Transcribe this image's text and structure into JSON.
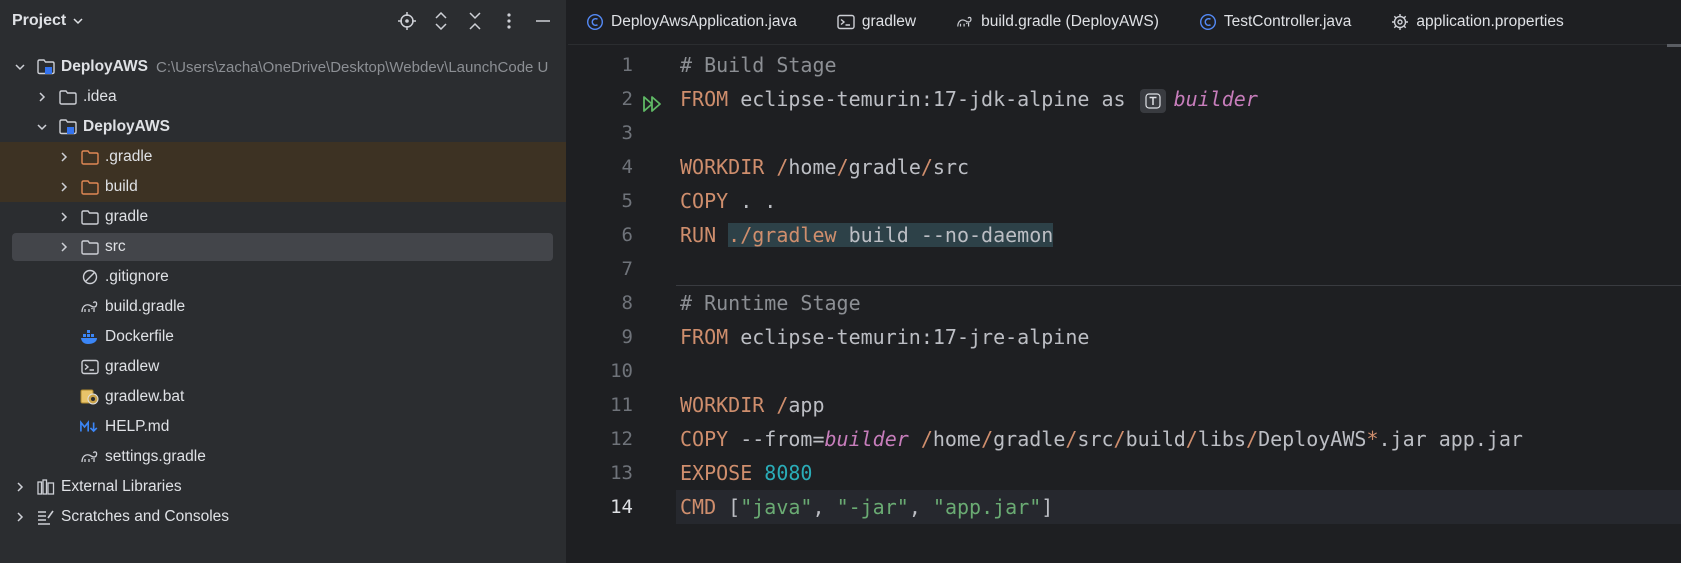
{
  "project_panel": {
    "title": "Project",
    "tools": [
      "locate-icon",
      "expand-all-icon",
      "collapse-all-icon",
      "more-icon",
      "hide-icon"
    ],
    "tree": [
      {
        "label": "DeployAWS",
        "path": "C:\\Users\\zacha\\OneDrive\\Desktop\\Webdev\\LaunchCode U",
        "icon": "module-icon",
        "chevron": "down",
        "depth": 0,
        "bold": true
      },
      {
        "label": ".idea",
        "icon": "folder-icon",
        "chevron": "right",
        "depth": 1
      },
      {
        "label": "DeployAWS",
        "icon": "module-icon",
        "chevron": "down",
        "depth": 1,
        "bold": true
      },
      {
        "label": ".gradle",
        "icon": "excluded-folder-icon",
        "chevron": "right",
        "depth": 2,
        "highlight": true
      },
      {
        "label": "build",
        "icon": "excluded-folder-icon",
        "chevron": "right",
        "depth": 2,
        "highlight": true
      },
      {
        "label": "gradle",
        "icon": "folder-icon",
        "chevron": "right",
        "depth": 2
      },
      {
        "label": "src",
        "icon": "folder-icon",
        "chevron": "right",
        "depth": 2,
        "selected": true
      },
      {
        "label": ".gitignore",
        "icon": "ignore-icon",
        "chevron": "none",
        "depth": 2
      },
      {
        "label": "build.gradle",
        "icon": "gradle-icon",
        "chevron": "none",
        "depth": 2
      },
      {
        "label": "Dockerfile",
        "icon": "docker-icon",
        "chevron": "none",
        "depth": 2
      },
      {
        "label": "gradlew",
        "icon": "terminal-icon",
        "chevron": "none",
        "depth": 2
      },
      {
        "label": "gradlew.bat",
        "icon": "bat-icon",
        "chevron": "none",
        "depth": 2
      },
      {
        "label": "HELP.md",
        "icon": "markdown-icon",
        "chevron": "none",
        "depth": 2
      },
      {
        "label": "settings.gradle",
        "icon": "gradle-icon",
        "chevron": "none",
        "depth": 2
      },
      {
        "label": "External Libraries",
        "icon": "library-icon",
        "chevron": "right",
        "depth": 0
      },
      {
        "label": "Scratches and Consoles",
        "icon": "scratches-icon",
        "chevron": "right",
        "depth": 0
      }
    ]
  },
  "tabs": [
    {
      "label": "DeployAwsApplication.java",
      "icon": "java-class-icon"
    },
    {
      "label": "gradlew",
      "icon": "terminal-icon"
    },
    {
      "label": "build.gradle (DeployAWS)",
      "icon": "gradle-icon"
    },
    {
      "label": "TestController.java",
      "icon": "java-class-icon"
    },
    {
      "label": "application.properties",
      "icon": "gear-icon"
    }
  ],
  "editor": {
    "line_numbers": [
      "1",
      "2",
      "3",
      "4",
      "5",
      "6",
      "7",
      "8",
      "9",
      "10",
      "11",
      "12",
      "13",
      "14"
    ],
    "current_line": 14,
    "lines": [
      [
        {
          "t": "# Build Stage",
          "c": "cm"
        }
      ],
      [
        {
          "t": "FROM",
          "c": "kw"
        },
        {
          "t": " eclipse-temurin:17-jdk-alpine as ",
          "c": ""
        },
        {
          "inlay": "type-hint-icon"
        },
        {
          "t": "builder",
          "c": "it"
        }
      ],
      [],
      [
        {
          "t": "WORKDIR",
          "c": "kw"
        },
        {
          "t": " ",
          "c": ""
        },
        {
          "t": "/",
          "c": "kw"
        },
        {
          "t": "home",
          "c": ""
        },
        {
          "t": "/",
          "c": "kw"
        },
        {
          "t": "gradle",
          "c": ""
        },
        {
          "t": "/",
          "c": "kw"
        },
        {
          "t": "src",
          "c": ""
        }
      ],
      [
        {
          "t": "COPY",
          "c": "kw"
        },
        {
          "t": " . .",
          "c": ""
        }
      ],
      [
        {
          "t": "RUN",
          "c": "kw"
        },
        {
          "t": " ",
          "c": ""
        },
        {
          "t": "./gradlew",
          "c": "kw",
          "hl": true
        },
        {
          "t": " build --no-daemon",
          "c": "",
          "hl": true
        }
      ],
      [],
      [
        {
          "t": "# Runtime Stage",
          "c": "cm"
        }
      ],
      [
        {
          "t": "FROM",
          "c": "kw"
        },
        {
          "t": " eclipse-temurin:17-jre-alpine",
          "c": ""
        }
      ],
      [],
      [
        {
          "t": "WORKDIR",
          "c": "kw"
        },
        {
          "t": " ",
          "c": ""
        },
        {
          "t": "/",
          "c": "kw"
        },
        {
          "t": "app",
          "c": ""
        }
      ],
      [
        {
          "t": "COPY",
          "c": "kw"
        },
        {
          "t": " --from=",
          "c": ""
        },
        {
          "t": "builder",
          "c": "it"
        },
        {
          "t": " ",
          "c": ""
        },
        {
          "t": "/",
          "c": "kw"
        },
        {
          "t": "home",
          "c": ""
        },
        {
          "t": "/",
          "c": "kw"
        },
        {
          "t": "gradle",
          "c": ""
        },
        {
          "t": "/",
          "c": "kw"
        },
        {
          "t": "src",
          "c": ""
        },
        {
          "t": "/",
          "c": "kw"
        },
        {
          "t": "build",
          "c": ""
        },
        {
          "t": "/",
          "c": "kw"
        },
        {
          "t": "libs",
          "c": ""
        },
        {
          "t": "/",
          "c": "kw"
        },
        {
          "t": "DeployAWS",
          "c": ""
        },
        {
          "t": "*",
          "c": "kw"
        },
        {
          "t": ".jar app.jar",
          "c": ""
        }
      ],
      [
        {
          "t": "EXPOSE",
          "c": "kw"
        },
        {
          "t": " ",
          "c": ""
        },
        {
          "t": "8080",
          "c": "nm"
        }
      ],
      [
        {
          "t": "CMD",
          "c": "kw"
        },
        {
          "t": " [",
          "c": ""
        },
        {
          "t": "\"java\"",
          "c": "st"
        },
        {
          "t": ", ",
          "c": ""
        },
        {
          "t": "\"-jar\"",
          "c": "st"
        },
        {
          "t": ", ",
          "c": ""
        },
        {
          "t": "\"app.jar\"",
          "c": "st"
        },
        {
          "t": "]",
          "c": ""
        }
      ]
    ]
  },
  "colors": {
    "keyword": "#cf8e6d",
    "comment": "#8c8f94",
    "string": "#6aab73",
    "number": "#2aacb8",
    "identifier_italic": "#c77dbb",
    "excluded_folder": "#e08855",
    "run_gutter": "#5fb865"
  }
}
